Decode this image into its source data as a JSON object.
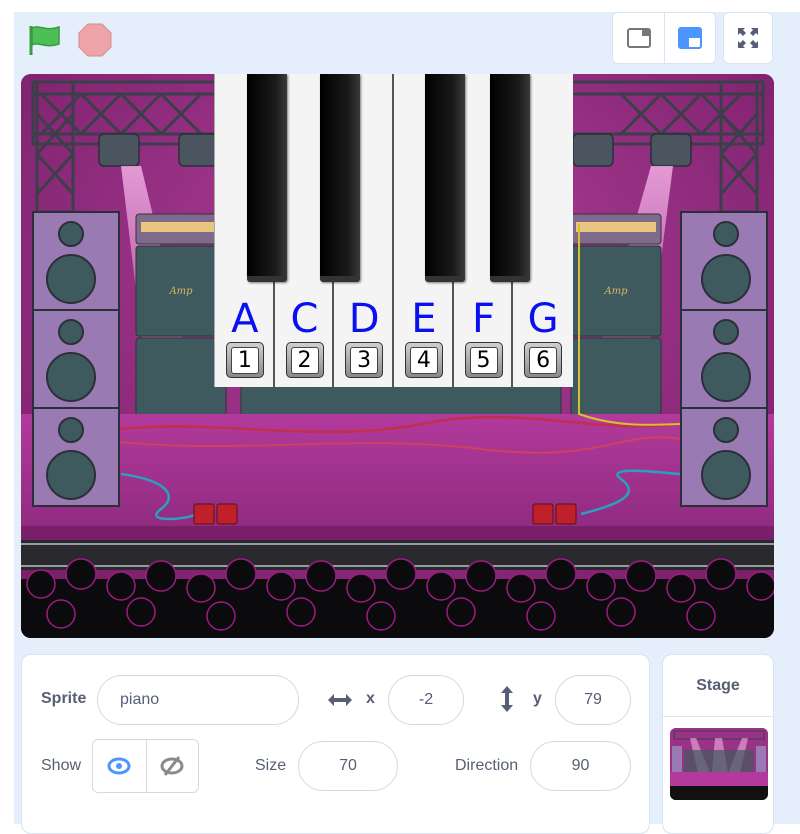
{
  "controls": {
    "green_flag_icon": "green-flag-icon",
    "stop_icon": "stop-sign-icon",
    "layout_small_stage_icon": "small-stage-icon",
    "layout_normal_stage_icon": "normal-stage-icon",
    "fullscreen_icon": "fullscreen-icon"
  },
  "stage": {
    "backdrop": "concert stage",
    "amp_label": "Amp",
    "piano": {
      "keys": [
        {
          "note": "A",
          "key": "1"
        },
        {
          "note": "C",
          "key": "2"
        },
        {
          "note": "D",
          "key": "3"
        },
        {
          "note": "E",
          "key": "4"
        },
        {
          "note": "F",
          "key": "5"
        },
        {
          "note": "G",
          "key": "6"
        }
      ]
    }
  },
  "sprite_info": {
    "sprite_label": "Sprite",
    "sprite_name": "piano",
    "x_label": "x",
    "x_value": "-2",
    "y_label": "y",
    "y_value": "79",
    "show_label": "Show",
    "size_label": "Size",
    "size_value": "70",
    "direction_label": "Direction",
    "direction_value": "90"
  },
  "stage_selector": {
    "title": "Stage"
  },
  "colors": {
    "accent": "#4c97ff",
    "workspace_bg": "#e5effc",
    "text": "#575e75",
    "flag": "#4cbf56",
    "stop": "#ec9c9c",
    "note_letter": "#0a10f0"
  }
}
